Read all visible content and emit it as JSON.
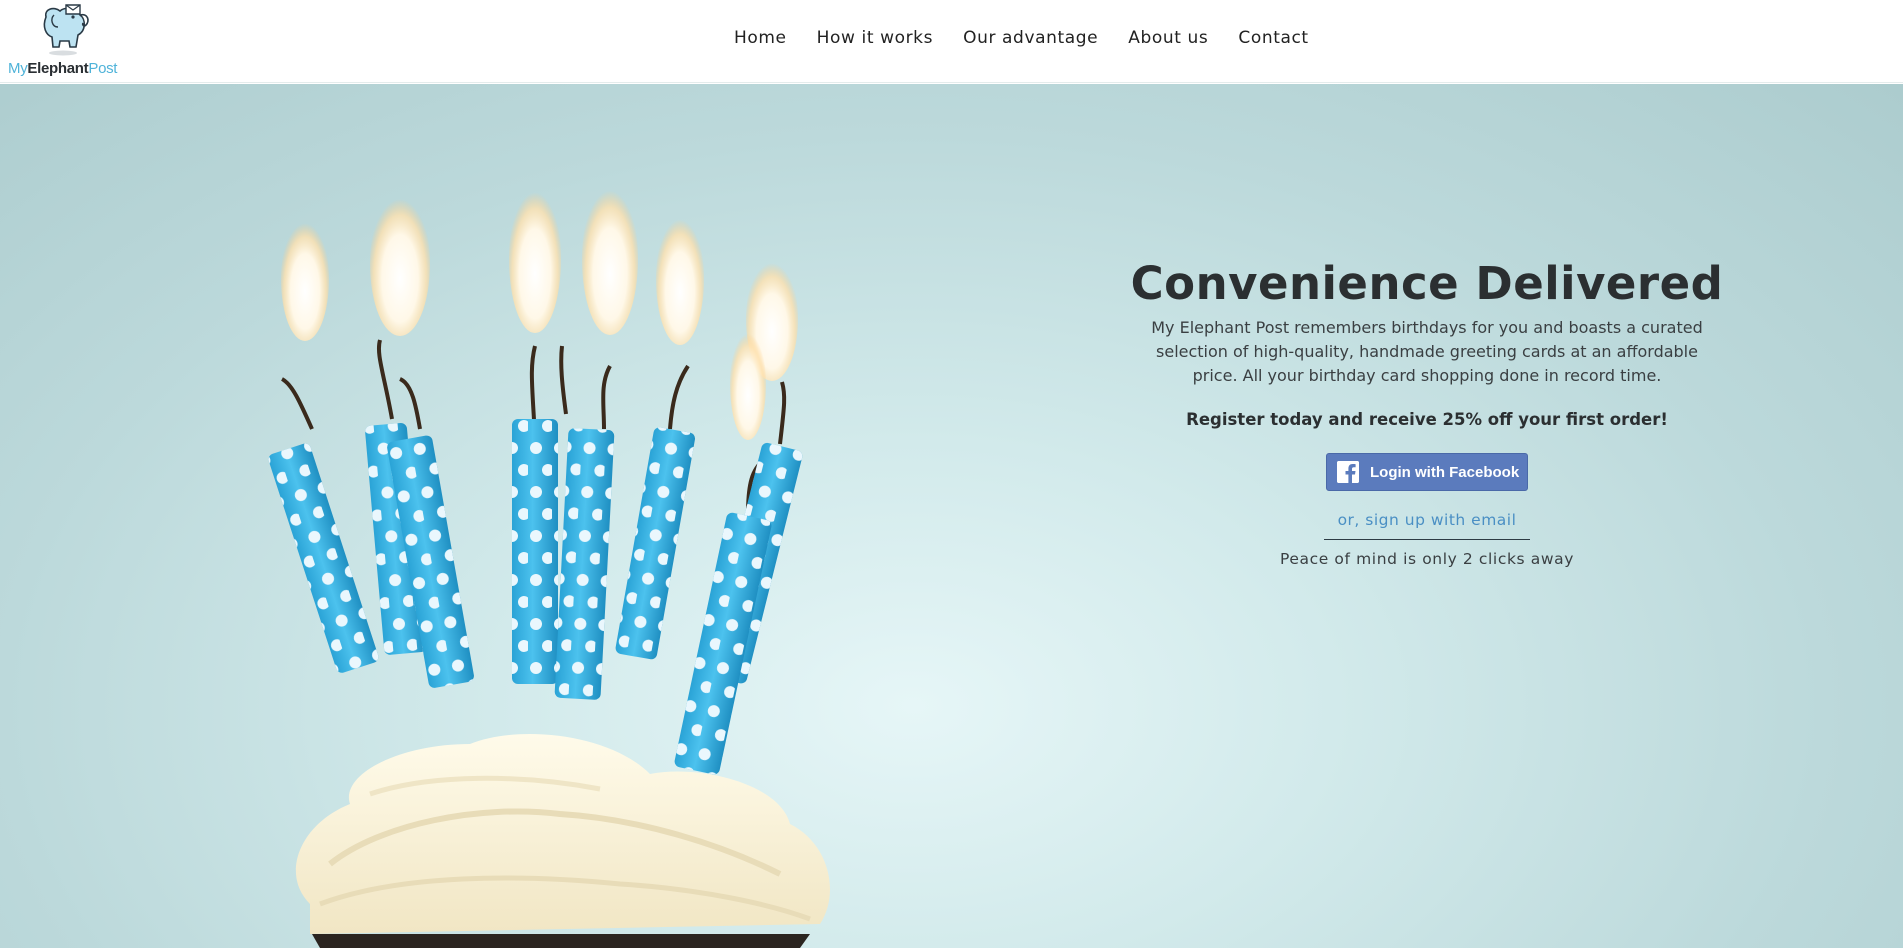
{
  "brand": {
    "logo_part1": "My",
    "logo_part2": "Elephant",
    "logo_part3": "Post",
    "logo_icon": "elephant-icon"
  },
  "nav": {
    "items": [
      "Home",
      "How it works",
      "Our advantage",
      "About us",
      "Contact"
    ]
  },
  "hero": {
    "headline": "Convenience Delivered",
    "description": "My Elephant Post remembers birthdays for you and boasts a curated selection of high-quality, handmade greeting cards at an affordable price. All your birthday card shopping done in record time.",
    "promo": "Register today and receive 25% off your first order!",
    "facebook_button": "Login with Facebook",
    "facebook_icon": "facebook-icon",
    "email_link": "or, sign up with email",
    "tagline": "Peace of mind is only 2 clicks away",
    "image": "birthday-cupcake-candles"
  },
  "colors": {
    "facebook": "#5b7bbd",
    "brand_blue": "#4fb3d9",
    "link": "#4a8fc4",
    "candle": "#3fb4e3",
    "hero_bg": "#c6e0e1"
  }
}
